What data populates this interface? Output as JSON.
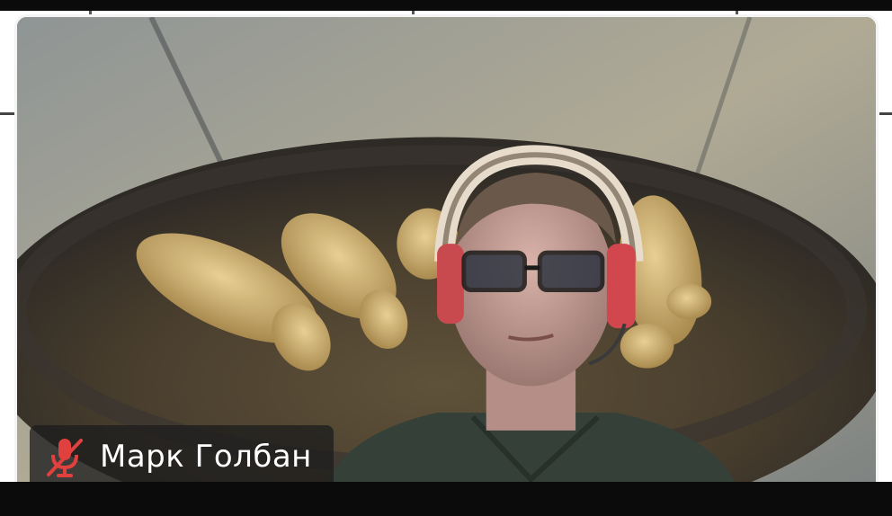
{
  "participant": {
    "name": "Марк Голбан",
    "mic_icon": "mic-muted-icon",
    "muted": true
  },
  "colors": {
    "muted_icon": "#e0413f",
    "tile_border": "#f4f4f4",
    "name_tag_bg": "#1e1e1e"
  }
}
